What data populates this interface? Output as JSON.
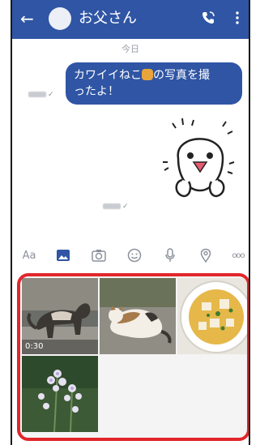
{
  "header": {
    "back_label": "←",
    "title": "お父さん"
  },
  "chat": {
    "date_label": "今日",
    "message_text": "カワイイねこ🐱の写真を撮ったよ！",
    "message_line1": "カワイイねこ",
    "message_line1b": "の写真を撮",
    "message_line2": "ったよ！",
    "read_mark": "✓"
  },
  "toolbar": {
    "items": [
      {
        "name": "text-style",
        "label": "Aa"
      },
      {
        "name": "gallery"
      },
      {
        "name": "camera"
      },
      {
        "name": "emoji"
      },
      {
        "name": "microphone"
      },
      {
        "name": "location"
      },
      {
        "name": "more",
        "label": "ooo"
      }
    ]
  },
  "gallery": {
    "items": [
      {
        "name": "video-cat",
        "duration": "0:30"
      },
      {
        "name": "photo-cat-lying"
      },
      {
        "name": "photo-soup"
      },
      {
        "name": "photo-flowers"
      }
    ]
  },
  "colors": {
    "accent": "#2f55a4",
    "highlight": "#e2262b"
  }
}
